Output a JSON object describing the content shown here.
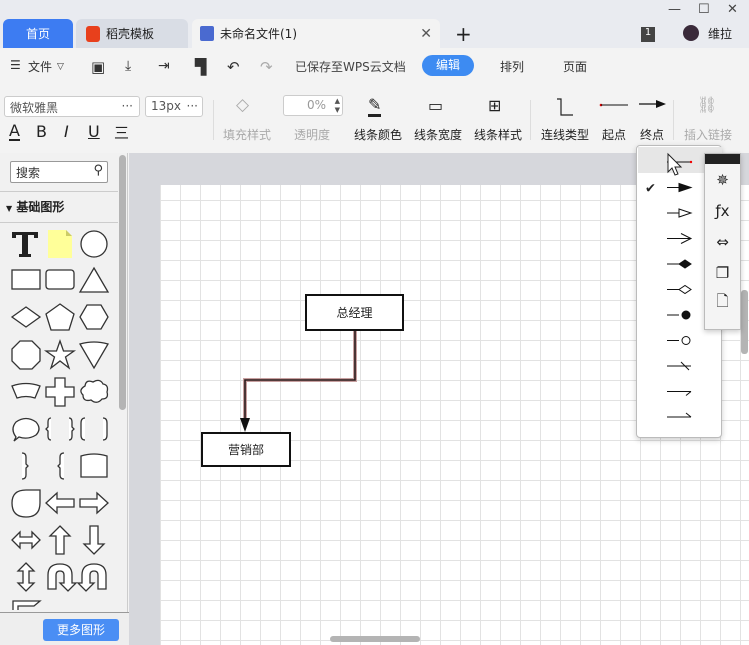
{
  "tabs": [
    {
      "label": "首页",
      "active": false
    },
    {
      "label": "稻壳模板",
      "icon": "docer-icon"
    },
    {
      "label": "未命名文件(1)",
      "icon": "flowchart-file-icon",
      "active": true
    }
  ],
  "user": {
    "name": "维拉",
    "badge": "1"
  },
  "toolbar": {
    "file": "文件",
    "saved_status": "已保存至WPS云文档",
    "mode_tabs": [
      {
        "label": "编辑",
        "active": true
      },
      {
        "label": "排列"
      },
      {
        "label": "页面"
      }
    ]
  },
  "format": {
    "font": "微软雅黑",
    "font_size": "13px",
    "opacity": "0%",
    "more": "···",
    "buttons": [
      {
        "label": "填充样式",
        "disabled": true
      },
      {
        "label": "透明度",
        "disabled": true
      },
      {
        "label": "线条颜色"
      },
      {
        "label": "线条宽度"
      },
      {
        "label": "线条样式"
      },
      {
        "label": "连线类型"
      },
      {
        "label": "起点"
      },
      {
        "label": "终点"
      },
      {
        "label": "插入链接",
        "disabled": true
      }
    ],
    "text_styles": [
      "A",
      "B",
      "I",
      "U",
      "三"
    ]
  },
  "sidebar": {
    "search_placeholder": "搜索",
    "section": "基础图形",
    "more_shapes": "更多图形",
    "shapes": [
      "text",
      "note",
      "circle",
      "rectangle",
      "rounded-rectangle",
      "triangle",
      "diamond",
      "pentagon",
      "hexagon",
      "octagon",
      "star",
      "inverted-triangle",
      "trapezoid-arc",
      "cross",
      "cloud",
      "speech-bubble",
      "braces",
      "brackets",
      "right-brace",
      "left-brace",
      "tape",
      "teardrop",
      "arrow-left",
      "arrow-right",
      "arrow-left-right",
      "arrow-up",
      "arrow-down",
      "arrow-up-down",
      "u-turn-left",
      "u-turn-right",
      "corner"
    ]
  },
  "diagram": {
    "nodes": [
      {
        "label": "总经理"
      },
      {
        "label": "营销部"
      }
    ],
    "connector_color": "#3a1a1a"
  },
  "endpoint_menu": {
    "selected_index": 1,
    "items": [
      "none",
      "block-filled",
      "block-open",
      "open-arrow",
      "diamond-filled",
      "diamond-open",
      "oval-filled",
      "oval-open",
      "dash",
      "half-arrow-top",
      "half-arrow-bottom"
    ]
  },
  "side_panel": {
    "icons": [
      "compass-icon",
      "formula-icon",
      "resize-icon",
      "pages-icon",
      "page-icon"
    ]
  },
  "colors": {
    "accent": "#3d7cf2"
  }
}
